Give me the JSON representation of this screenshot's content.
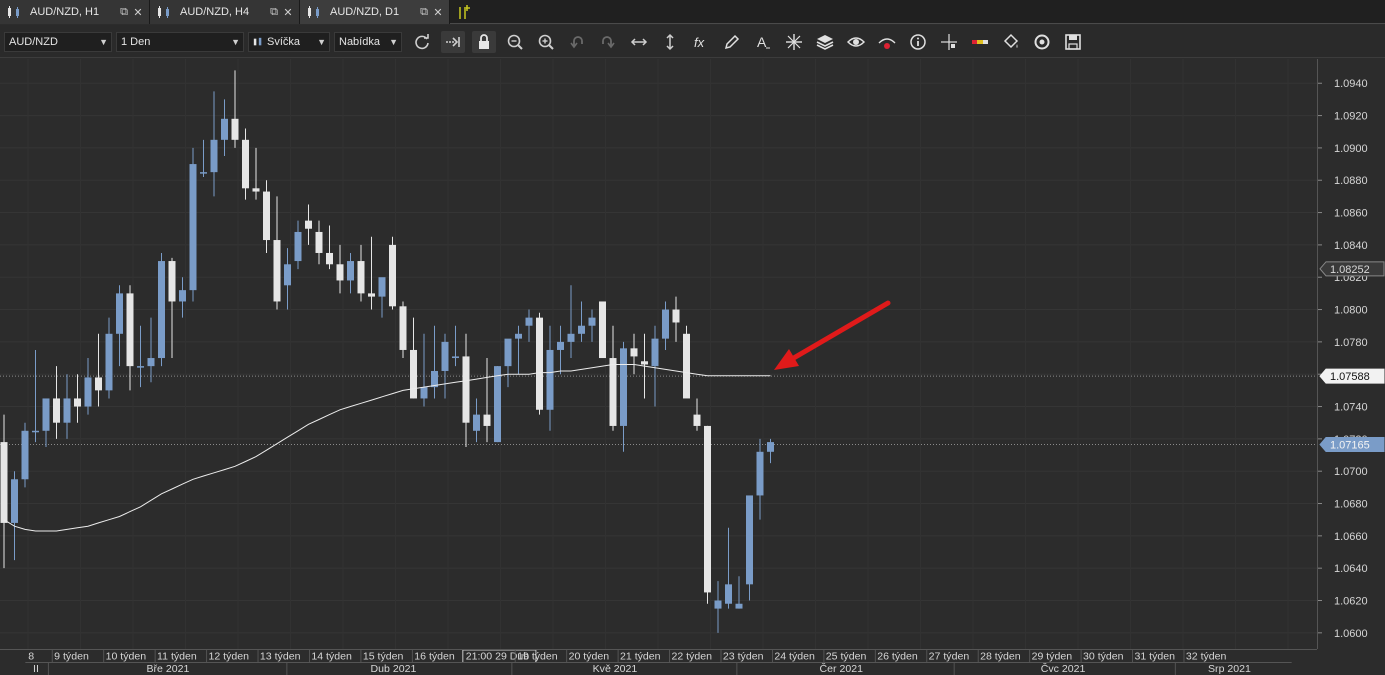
{
  "tabs": [
    {
      "label": "AUD/NZD, H1",
      "active": false
    },
    {
      "label": "AUD/NZD, H4",
      "active": false
    },
    {
      "label": "AUD/NZD, D1",
      "active": true
    }
  ],
  "toolbar": {
    "symbol": "AUD/NZD",
    "period": "1 Den",
    "chart_style": "Svíčka",
    "menu": "Nabídka",
    "tools": [
      "refresh-icon",
      "auto-scroll-icon",
      "lock-icon",
      "zoom-in-icon",
      "zoom-out-icon",
      "undo-icon",
      "redo-icon",
      "fit-horizontal-icon",
      "fit-vertical-icon",
      "indicators-fx-icon",
      "pencil-icon",
      "text-tool-icon",
      "crosshair-icon",
      "layers-icon",
      "eye-icon",
      "alerts-icon",
      "info-icon",
      "cursor-cross-icon",
      "color-bar-icon",
      "paint-bucket-icon",
      "reload-circle-icon",
      "save-icon"
    ]
  },
  "colors": {
    "background": "#2c2c2c",
    "bull_candle": "#7a9cc8",
    "bear_candle": "#e6e6e6",
    "moving_average": "#ececec",
    "annotation_arrow": "#e01a1a"
  },
  "chart_data": {
    "type": "candlestick",
    "symbol": "AUD/NZD",
    "timeframe": "D1",
    "ylim": [
      1.059,
      1.0955
    ],
    "y_ticks": [
      "1.0600",
      "1.0620",
      "1.0640",
      "1.0660",
      "1.0680",
      "1.0700",
      "1.0720",
      "1.0740",
      "1.0760",
      "1.0780",
      "1.0800",
      "1.0820",
      "1.0840",
      "1.0860",
      "1.0880",
      "1.0900",
      "1.0920",
      "1.0940"
    ],
    "price_labels": [
      {
        "text": "1.08252",
        "value": 1.08252,
        "style": "gray"
      },
      {
        "text": "1.07588",
        "value": 1.07588,
        "style": "white"
      },
      {
        "text": "1.07165",
        "value": 1.07165,
        "style": "blue"
      }
    ],
    "week_labels": [
      "9 týden",
      "10 týden",
      "11 týden",
      "12 týden",
      "13 týden",
      "14 týden",
      "15 týden",
      "16 týden",
      "21:00 29 Dub",
      "19 týden",
      "20 týden",
      "21 týden",
      "22 týden",
      "23 týden",
      "24 týden",
      "25 týden",
      "26 týden",
      "27 týden",
      "28 týden",
      "29 týden",
      "30 týden",
      "31 týden",
      "32 týden"
    ],
    "edge_labels": {
      "top_left": "8",
      "bottom_left": "II"
    },
    "month_labels": [
      "Bře 2021",
      "Dub 2021",
      "Kvě 2021",
      "Čer 2021",
      "Čvc 2021",
      "Srp 2021"
    ],
    "candles": [
      [
        1.0718,
        1.0735,
        1.064,
        1.0668
      ],
      [
        1.0668,
        1.07,
        1.0645,
        1.0695
      ],
      [
        1.0695,
        1.073,
        1.069,
        1.0725
      ],
      [
        1.0725,
        1.0775,
        1.0718,
        1.0725
      ],
      [
        1.0725,
        1.074,
        1.0715,
        1.0745
      ],
      [
        1.0745,
        1.0765,
        1.072,
        1.073
      ],
      [
        1.073,
        1.076,
        1.072,
        1.0745
      ],
      [
        1.0745,
        1.076,
        1.073,
        1.074
      ],
      [
        1.074,
        1.077,
        1.0735,
        1.0758
      ],
      [
        1.0758,
        1.0785,
        1.074,
        1.075
      ],
      [
        1.075,
        1.0795,
        1.0745,
        1.0785
      ],
      [
        1.0785,
        1.0815,
        1.0765,
        1.081
      ],
      [
        1.081,
        1.0815,
        1.075,
        1.0765
      ],
      [
        1.0765,
        1.079,
        1.0752,
        1.0765
      ],
      [
        1.0765,
        1.0795,
        1.0755,
        1.077
      ],
      [
        1.077,
        1.0835,
        1.0765,
        1.083
      ],
      [
        1.083,
        1.0832,
        1.077,
        1.0805
      ],
      [
        1.0805,
        1.082,
        1.0795,
        1.0812
      ],
      [
        1.0812,
        1.09,
        1.0805,
        1.089
      ],
      [
        1.0885,
        1.0905,
        1.0882,
        1.0885
      ],
      [
        1.0885,
        1.0935,
        1.087,
        1.0905
      ],
      [
        1.0905,
        1.093,
        1.0895,
        1.0918
      ],
      [
        1.0918,
        1.0948,
        1.09,
        1.0905
      ],
      [
        1.0905,
        1.0912,
        1.0868,
        1.0875
      ],
      [
        1.0875,
        1.09,
        1.0868,
        1.0873
      ],
      [
        1.0873,
        1.088,
        1.0835,
        1.0843
      ],
      [
        1.0843,
        1.087,
        1.08,
        1.0805
      ],
      [
        1.0815,
        1.0838,
        1.08,
        1.0828
      ],
      [
        1.083,
        1.0855,
        1.0825,
        1.0848
      ],
      [
        1.0855,
        1.0865,
        1.084,
        1.085
      ],
      [
        1.0848,
        1.0855,
        1.0828,
        1.0835
      ],
      [
        1.0835,
        1.0852,
        1.0825,
        1.0828
      ],
      [
        1.0828,
        1.084,
        1.081,
        1.0818
      ],
      [
        1.0818,
        1.0835,
        1.081,
        1.083
      ],
      [
        1.083,
        1.084,
        1.0805,
        1.081
      ],
      [
        1.081,
        1.0845,
        1.08,
        1.0808
      ],
      [
        1.0808,
        1.0815,
        1.0795,
        1.082
      ],
      [
        1.084,
        1.0845,
        1.08,
        1.0802
      ],
      [
        1.0802,
        1.0805,
        1.077,
        1.0775
      ],
      [
        1.0775,
        1.0795,
        1.0745,
        1.0745
      ],
      [
        1.0745,
        1.0785,
        1.074,
        1.0752
      ],
      [
        1.0752,
        1.079,
        1.0745,
        1.0762
      ],
      [
        1.0762,
        1.0785,
        1.0745,
        1.078
      ],
      [
        1.077,
        1.079,
        1.0765,
        1.0771
      ],
      [
        1.0771,
        1.0785,
        1.0715,
        1.073
      ],
      [
        1.0725,
        1.0745,
        1.0718,
        1.0735
      ],
      [
        1.0735,
        1.077,
        1.0718,
        1.0728
      ],
      [
        1.0718,
        1.0765,
        1.0718,
        1.0765
      ],
      [
        1.0765,
        1.078,
        1.0752,
        1.0782
      ],
      [
        1.0782,
        1.079,
        1.076,
        1.0785
      ],
      [
        1.079,
        1.08,
        1.078,
        1.0795
      ],
      [
        1.0795,
        1.0798,
        1.0735,
        1.0738
      ],
      [
        1.0738,
        1.079,
        1.0725,
        1.0775
      ],
      [
        1.0775,
        1.079,
        1.076,
        1.078
      ],
      [
        1.078,
        1.0815,
        1.077,
        1.0785
      ],
      [
        1.0785,
        1.0805,
        1.078,
        1.079
      ],
      [
        1.079,
        1.08,
        1.078,
        1.0795
      ],
      [
        1.0805,
        1.0805,
        1.077,
        1.077
      ],
      [
        1.077,
        1.079,
        1.0725,
        1.0728
      ],
      [
        1.0728,
        1.078,
        1.0712,
        1.0776
      ],
      [
        1.0776,
        1.0785,
        1.076,
        1.0771
      ],
      [
        1.0768,
        1.0785,
        1.0745,
        1.0766
      ],
      [
        1.0765,
        1.079,
        1.074,
        1.0782
      ],
      [
        1.0782,
        1.0805,
        1.0775,
        1.08
      ],
      [
        1.08,
        1.0808,
        1.078,
        1.0792
      ],
      [
        1.0785,
        1.079,
        1.075,
        1.0745
      ],
      [
        1.0735,
        1.0745,
        1.0725,
        1.0728
      ],
      [
        1.0728,
        1.0728,
        1.0618,
        1.0625
      ],
      [
        1.0615,
        1.0632,
        1.06,
        1.062
      ],
      [
        1.0618,
        1.0665,
        1.0615,
        1.063
      ],
      [
        1.0615,
        1.0635,
        1.0615,
        1.0618
      ],
      [
        1.063,
        1.0685,
        1.062,
        1.0685
      ],
      [
        1.0685,
        1.072,
        1.067,
        1.0712
      ],
      [
        1.0712,
        1.072,
        1.0705,
        1.0718
      ]
    ],
    "moving_average": [
      1.067,
      1.0666,
      1.0664,
      1.0663,
      1.0663,
      1.0663,
      1.0664,
      1.0665,
      1.0666,
      1.0668,
      1.067,
      1.0672,
      1.0675,
      1.0678,
      1.0682,
      1.0686,
      1.0689,
      1.0692,
      1.0695,
      1.0697,
      1.0699,
      1.0701,
      1.0703,
      1.0706,
      1.0709,
      1.0713,
      1.0717,
      1.0721,
      1.0725,
      1.0729,
      1.0732,
      1.0735,
      1.0738,
      1.074,
      1.0742,
      1.0744,
      1.0746,
      1.0748,
      1.075,
      1.0751,
      1.0752,
      1.0753,
      1.0754,
      1.0755,
      1.0756,
      1.0757,
      1.0758,
      1.0759,
      1.076,
      1.076,
      1.076,
      1.0761,
      1.0761,
      1.0762,
      1.0762,
      1.0763,
      1.0764,
      1.0765,
      1.0766,
      1.0766,
      1.0766,
      1.0765,
      1.0764,
      1.0763,
      1.0762,
      1.0761,
      1.076,
      1.0759,
      1.0759,
      1.0759,
      1.0759,
      1.0759,
      1.0759,
      1.0759
    ],
    "horizontal_lines": [
      1.07588,
      1.07165
    ],
    "annotation": {
      "type": "arrow",
      "color": "#e01a1a"
    }
  }
}
